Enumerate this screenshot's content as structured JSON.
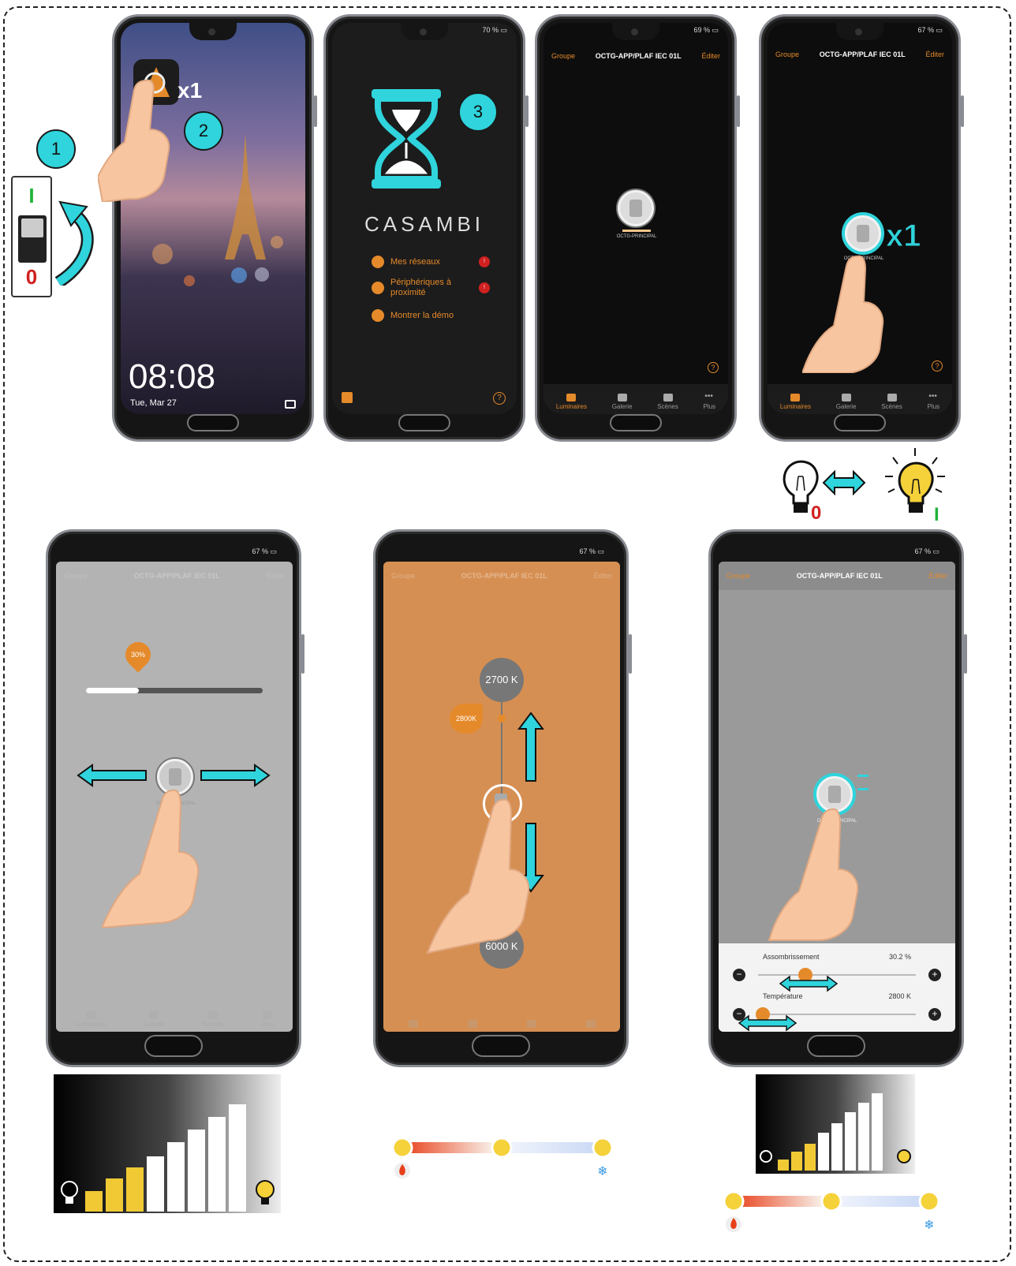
{
  "step_badges": [
    "1",
    "2",
    "3"
  ],
  "tap_counts": [
    "x1",
    "x1"
  ],
  "switch_states": {
    "on": "I",
    "off": "0"
  },
  "lockscreen": {
    "time": "08:08",
    "date": "Tue, Mar 27"
  },
  "splash": {
    "battery": "70 %",
    "brand": "CASAMBI",
    "menu": [
      {
        "label": "Mes réseaux",
        "badge": "!"
      },
      {
        "label": "Périphériques à proximité",
        "badge": "!"
      },
      {
        "label": "Montrer la démo",
        "badge": ""
      }
    ]
  },
  "app": {
    "left": "Groupe",
    "title": "OCTG-APP/PLAF IEC 01L",
    "right": "Éditer",
    "luminaire": "OCTG-PRINCIPAL",
    "tabs": [
      "Luminaires",
      "Galerie",
      "Scènes",
      "Plus"
    ],
    "help": "?"
  },
  "battery": {
    "s3": "69 %",
    "s4": "67 %",
    "s5": "67 %",
    "s6": "67 %",
    "s7": "67 %"
  },
  "dimmer": {
    "percent_label": "30%",
    "level": 0.3
  },
  "cct": {
    "top": "2700 K",
    "current": "2800K",
    "bottom": "6000 K"
  },
  "panel": {
    "dim_label": "Assombrissement",
    "dim_value": "30.2 %",
    "dim_level": 0.3,
    "temp_label": "Température",
    "temp_value": "2800 K",
    "temp_level": 0.03
  },
  "colors": {
    "cyan": "#2fd4dc",
    "orange": "#e58a2a",
    "bulb_yellow": "#f5d13a",
    "bar_yellow": "#f0c935",
    "warm": "#e8401a",
    "cold": "#c8d8f5"
  }
}
